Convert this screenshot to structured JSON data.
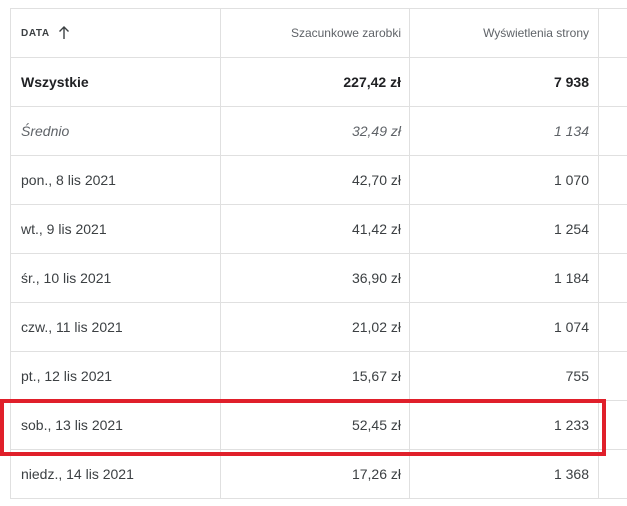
{
  "table": {
    "headers": {
      "date": "DATA",
      "earnings": "Szacunkowe zarobki",
      "views": "Wyświetlenia strony"
    },
    "summary": {
      "total": {
        "label": "Wszystkie",
        "earnings": "227,42 zł",
        "views": "7 938"
      },
      "average": {
        "label": "Średnio",
        "earnings": "32,49 zł",
        "views": "1 134"
      }
    },
    "rows": [
      {
        "date": "pon., 8 lis 2021",
        "earnings": "42,70 zł",
        "views": "1 070"
      },
      {
        "date": "wt., 9 lis 2021",
        "earnings": "41,42 zł",
        "views": "1 254"
      },
      {
        "date": "śr., 10 lis 2021",
        "earnings": "36,90 zł",
        "views": "1 184"
      },
      {
        "date": "czw., 11 lis 2021",
        "earnings": "21,02 zł",
        "views": "1 074"
      },
      {
        "date": "pt., 12 lis 2021",
        "earnings": "15,67 zł",
        "views": "755"
      },
      {
        "date": "sob., 13 lis 2021",
        "earnings": "52,45 zł",
        "views": "1 233"
      },
      {
        "date": "niedz., 14 lis 2021",
        "earnings": "17,26 zł",
        "views": "1 368"
      }
    ],
    "highlight_color": "#e01f2a",
    "sort_icon": "arrow-up-icon"
  }
}
